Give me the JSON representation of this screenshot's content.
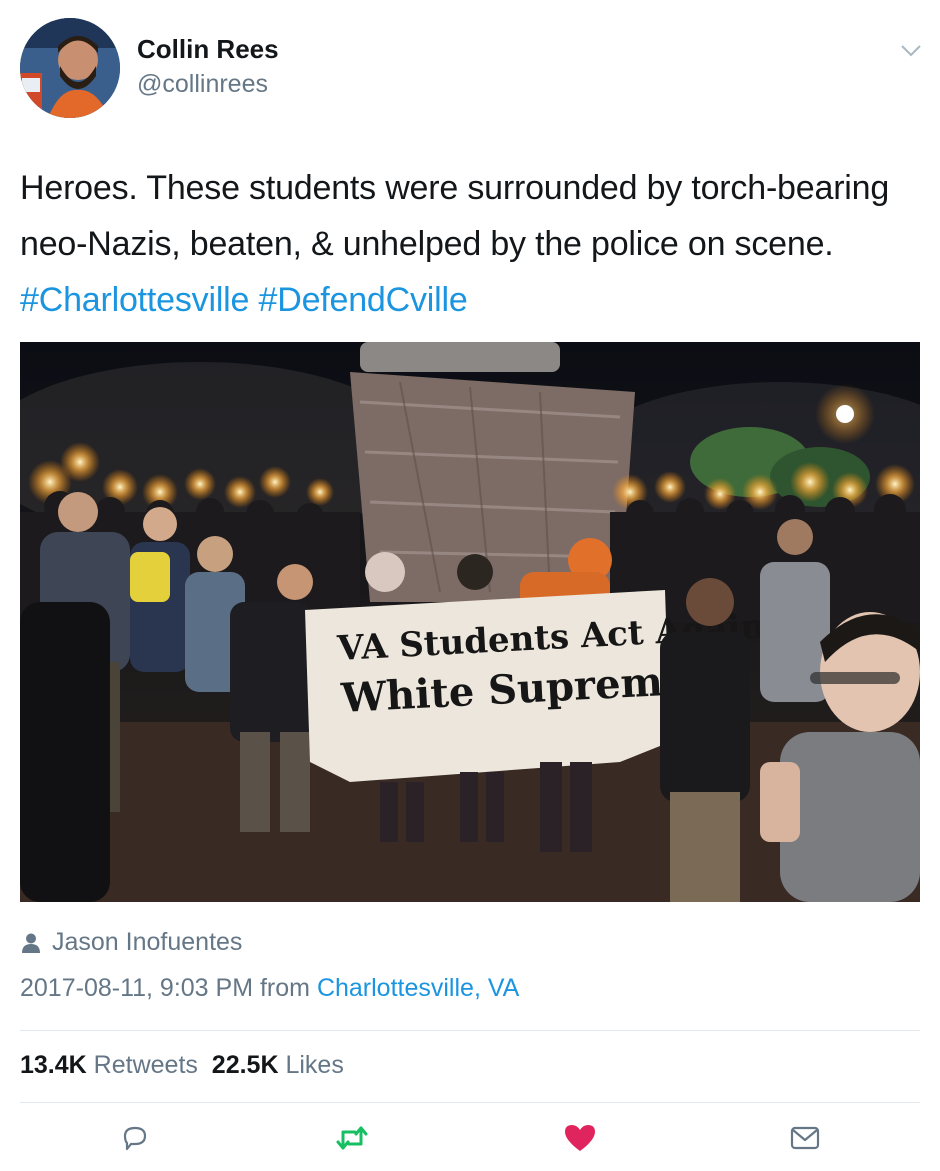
{
  "author": {
    "name": "Collin Rees",
    "handle": "@collinrees",
    "avatar_icon": "avatar-photo"
  },
  "tweet": {
    "text_plain": "Heroes. These students were surrounded by torch-bearing neo-Nazis, beaten, & unhelped by the police on scene. ",
    "hashtags": [
      "#Charlottesville",
      "#DefendCville"
    ]
  },
  "photo": {
    "banner_line1": "VA Students Act Agains",
    "banner_line2": "White Supremacy"
  },
  "credit": {
    "icon": "person-icon",
    "name": "Jason Inofuentes"
  },
  "meta": {
    "timestamp": "2017-08-11, 9:03 PM",
    "from_label": " from ",
    "location": "Charlottesville, VA"
  },
  "stats": {
    "retweets_count": "13.4K",
    "retweets_label": "Retweets",
    "likes_count": "22.5K",
    "likes_label": "Likes"
  },
  "actions": {
    "reply_icon": "reply-icon",
    "retweet_icon": "retweet-icon",
    "like_icon": "heart-icon",
    "dm_icon": "envelope-icon"
  },
  "colors": {
    "link": "#1b95e0",
    "secondary_text": "#657786",
    "retweet": "#17bf63",
    "like": "#e0245e",
    "divider": "#e1e8ed"
  }
}
